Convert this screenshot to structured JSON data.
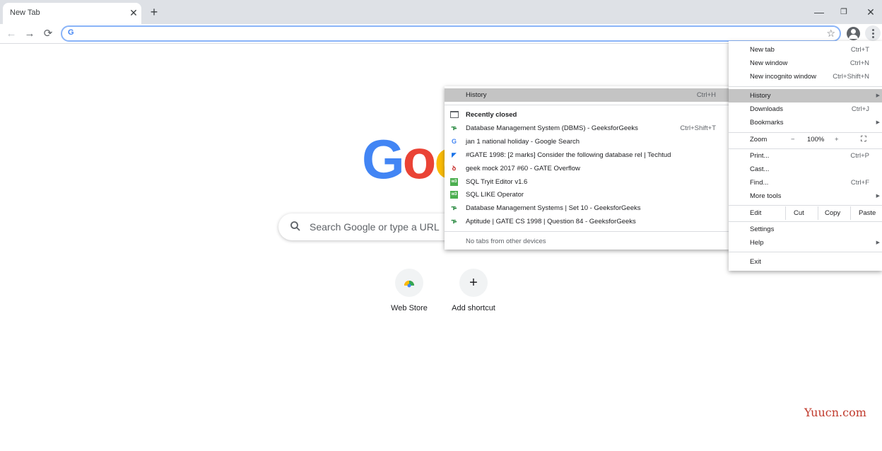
{
  "tab": {
    "title": "New Tab",
    "close_glyph": "✕"
  },
  "window_controls": {
    "minimize": "—",
    "restore": "❐",
    "close": "✕"
  },
  "toolbar": {
    "back_glyph": "←",
    "forward_glyph": "→",
    "reload_glyph": "⟳",
    "omnibox_value": "",
    "omnibox_icon": "G"
  },
  "ntp": {
    "logo_letters": [
      "G",
      "o",
      "o"
    ],
    "logo_colors": [
      "#4285f4",
      "#ea4335",
      "#fbbc05"
    ],
    "search_placeholder": "Search Google or type a URL",
    "shortcuts": [
      {
        "label": "Web Store",
        "icon": "webstore-icon"
      },
      {
        "label": "Add shortcut",
        "icon": "plus-icon",
        "glyph": "+"
      }
    ]
  },
  "main_menu": {
    "items": [
      {
        "label": "New tab",
        "shortcut": "Ctrl+T"
      },
      {
        "label": "New window",
        "shortcut": "Ctrl+N"
      },
      {
        "label": "New incognito window",
        "shortcut": "Ctrl+Shift+N"
      },
      {
        "label": "History",
        "shortcut": "",
        "submenu": true,
        "highlighted": true
      },
      {
        "label": "Downloads",
        "shortcut": "Ctrl+J"
      },
      {
        "label": "Bookmarks",
        "shortcut": "",
        "submenu": true
      },
      {
        "label": "Print...",
        "shortcut": "Ctrl+P"
      },
      {
        "label": "Cast...",
        "shortcut": ""
      },
      {
        "label": "Find...",
        "shortcut": "Ctrl+F"
      },
      {
        "label": "More tools",
        "shortcut": "",
        "submenu": true
      },
      {
        "label": "Settings",
        "shortcut": ""
      },
      {
        "label": "Help",
        "shortcut": "",
        "submenu": true
      },
      {
        "label": "Exit",
        "shortcut": ""
      }
    ],
    "zoom": {
      "label": "Zoom",
      "minus": "−",
      "value": "100%",
      "plus": "+",
      "fullscreen_glyph": "⛶"
    },
    "edit": {
      "label": "Edit",
      "cut": "Cut",
      "copy": "Copy",
      "paste": "Paste"
    }
  },
  "history_menu": {
    "header": {
      "label": "History",
      "shortcut": "Ctrl+H"
    },
    "recently_closed_label": "Recently closed",
    "entries": [
      {
        "title": "Database Management System (DBMS) - GeeksforGeeks",
        "shortcut": "Ctrl+Shift+T",
        "icon": "gfg-icon",
        "glyph": "ᎏ",
        "color": "#2f8d46"
      },
      {
        "title": "jan 1 national holiday - Google Search",
        "shortcut": "",
        "icon": "google-icon",
        "glyph": "G",
        "color": "#4285f4"
      },
      {
        "title": "#GATE 1998: [2 marks] Consider the following database rel | Techtud",
        "shortcut": "",
        "icon": "techtud-icon",
        "glyph": "◤",
        "color": "#1a73e8"
      },
      {
        "title": "geek mock 2017 #60 - GATE Overflow",
        "shortcut": "",
        "icon": "gate-overflow-icon",
        "glyph": "ꝺ",
        "color": "#c5221f"
      },
      {
        "title": "SQL Tryit Editor v1.6",
        "shortcut": "",
        "icon": "w3schools-icon",
        "glyph": "w3",
        "color": "#4caf50"
      },
      {
        "title": "SQL LIKE Operator",
        "shortcut": "",
        "icon": "w3schools-icon",
        "glyph": "w3",
        "color": "#4caf50"
      },
      {
        "title": "Database Management Systems | Set 10 - GeeksforGeeks",
        "shortcut": "",
        "icon": "gfg-icon",
        "glyph": "ᎏ",
        "color": "#2f8d46"
      },
      {
        "title": "Aptitude | GATE CS 1998 | Question 84 - GeeksforGeeks",
        "shortcut": "",
        "icon": "gfg-icon",
        "glyph": "ᎏ",
        "color": "#2f8d46"
      }
    ],
    "no_tabs_label": "No tabs from other devices"
  },
  "watermark": "Yuucn.com"
}
